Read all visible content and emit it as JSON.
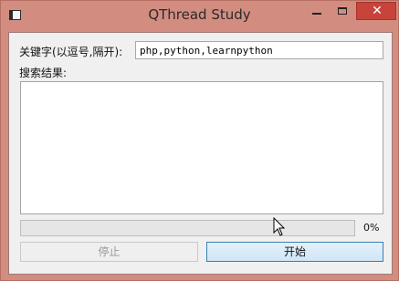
{
  "window": {
    "title": "QThread Study",
    "close_glyph": "✕"
  },
  "form": {
    "keyword_label": "关键字(以逗号,隔开):",
    "keyword_value": "php,python,learnpython",
    "results_label": "搜索结果:",
    "results_text": ""
  },
  "progress": {
    "value": 0,
    "text": "0%"
  },
  "buttons": {
    "stop_label": "停止",
    "start_label": "开始"
  },
  "colors": {
    "window_frame": "#d28d80",
    "close_button": "#c7443b",
    "progress_fill": "#06b025",
    "start_button_border": "#3c7fb1"
  }
}
